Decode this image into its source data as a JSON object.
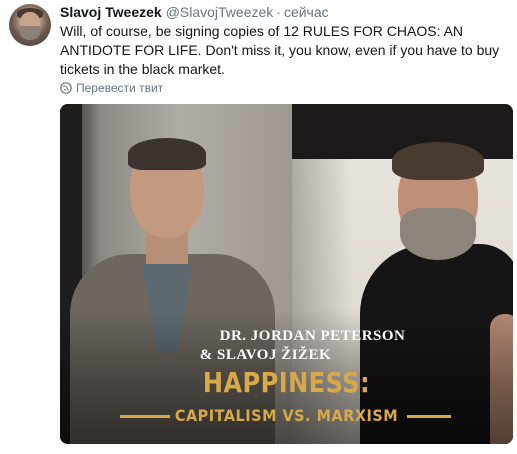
{
  "tweet": {
    "author_name": "Slavoj Tweezek",
    "handle": "@SlavojTweezek",
    "separator": "·",
    "time": "сейчас",
    "text": "Will, of course, be signing copies of 12 RULES FOR CHAOS: AN ANTIDOTE FOR LIFE. Don't miss it, you know, even if you have to buy tickets in the black market.",
    "translate_label": "Перевести твит",
    "translate_icon": "globe-icon",
    "colors": {
      "text": "#14171a",
      "secondary": "#657786",
      "poster_gold": "#d8a949"
    }
  },
  "media": {
    "line1": "DR. JORDAN PETERSON",
    "line2": "& SLAVOJ ŽIŽEK",
    "title": "HAPPINESS:",
    "subtitle": "CAPITALISM VS. MARXISM"
  }
}
